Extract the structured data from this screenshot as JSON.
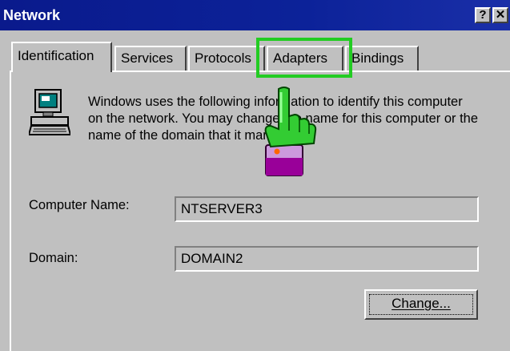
{
  "window": {
    "title": "Network",
    "help_label": "?",
    "close_label": "✕"
  },
  "tabs": [
    {
      "label": "Identification",
      "active": true
    },
    {
      "label": "Services",
      "active": false
    },
    {
      "label": "Protocols",
      "active": false
    },
    {
      "label": "Adapters",
      "active": false
    },
    {
      "label": "Bindings",
      "active": false
    }
  ],
  "identification": {
    "description": "Windows uses the following information to identify this computer on the network.  You may change the name for this computer or the name of the domain that it manages.",
    "computer_name_label": "Computer Name:",
    "computer_name_value": "NTSERVER3",
    "domain_label": "Domain:",
    "domain_value": "DOMAIN2",
    "change_label": "Change..."
  },
  "annotation": {
    "highlight_color": "#22cc22",
    "cursor_icon": "pointing-hand-cursor-icon"
  }
}
